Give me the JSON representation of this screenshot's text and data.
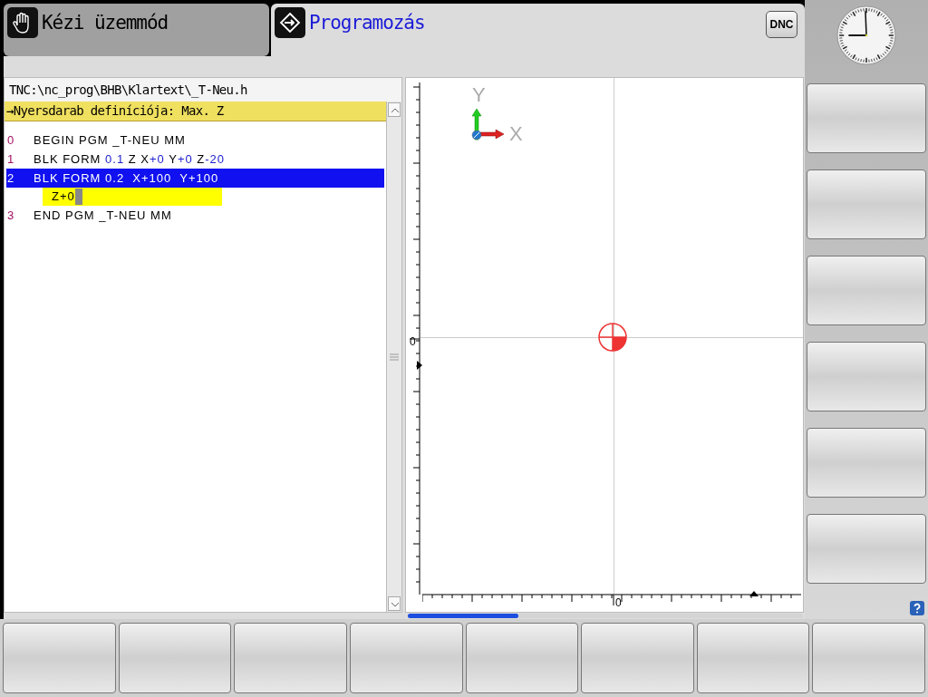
{
  "tabs": [
    {
      "label": "Kézi üzemmód",
      "selected": false,
      "kind": "hand"
    },
    {
      "label": "Programozás",
      "selected": true,
      "kind": "program"
    }
  ],
  "dnc_button": "DNC",
  "program": {
    "path": "TNC:\\nc_prog\\BHB\\Klartext\\_T-Neu.h",
    "prompt": "→Nyersdarab definíciója: Max. Z",
    "lines": [
      {
        "number": "0",
        "selected": false,
        "tokens": [
          {
            "text": "BEGIN PGM _T-NEU MM",
            "kind": "word"
          }
        ]
      },
      {
        "number": "1",
        "selected": false,
        "tokens": [
          {
            "text": "BLK FORM ",
            "kind": "word"
          },
          {
            "text": "0.1",
            "kind": "value"
          },
          {
            "text": " Z X",
            "kind": "word"
          },
          {
            "text": "+0",
            "kind": "value"
          },
          {
            "text": " Y",
            "kind": "word"
          },
          {
            "text": "+0",
            "kind": "value"
          },
          {
            "text": " Z",
            "kind": "word"
          },
          {
            "text": "-20",
            "kind": "value"
          }
        ]
      },
      {
        "number": "2",
        "selected": true,
        "tokens": [
          {
            "text": "BLK FORM 0.2  X+100  Y+100",
            "kind": "word"
          }
        ],
        "input": "Z+0"
      },
      {
        "number": "3",
        "selected": false,
        "tokens": [
          {
            "text": "END PGM _T-NEU MM",
            "kind": "word"
          }
        ]
      }
    ]
  },
  "softkey_page_indicator": {
    "level": 0.28
  },
  "graphic": {
    "y_axis_label": "Y",
    "x_axis_label": "X",
    "left_ruler_zero": "0",
    "bottom_ruler_zero": "0"
  }
}
